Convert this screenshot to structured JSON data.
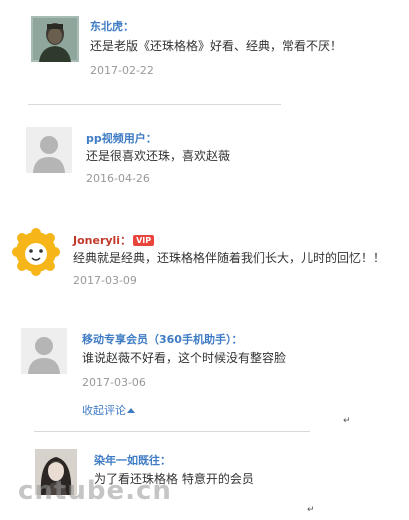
{
  "comments": [
    {
      "username": "东北虎：",
      "text": "还是老版《还珠格格》好看、经典，常看不厌！",
      "date": "2017-02-22"
    },
    {
      "username": "pp视频用户：",
      "text": "还是很喜欢还珠，喜欢赵薇",
      "date": "2016-04-26"
    },
    {
      "username": "Joneryli：",
      "badge": "VIP",
      "text": "经典就是经典，还珠格格伴随着我们长大，儿时的回忆！！",
      "date": "2017-03-09"
    },
    {
      "username": "移动专享会员（360手机助手）：",
      "text": "谁说赵薇不好看，这个时候没有整容脸",
      "date": "2017-03-06",
      "collapse_label": "收起评论"
    },
    {
      "username": "染年一如既往：",
      "text": "为了看还珠格格 特意开的会员"
    }
  ],
  "return_mark": "↵",
  "watermark": "cntube.cn",
  "colors": {
    "link": "#3f7cc4",
    "vip_badge": "#e8453c",
    "avatar_yellow": "#f6b519"
  }
}
